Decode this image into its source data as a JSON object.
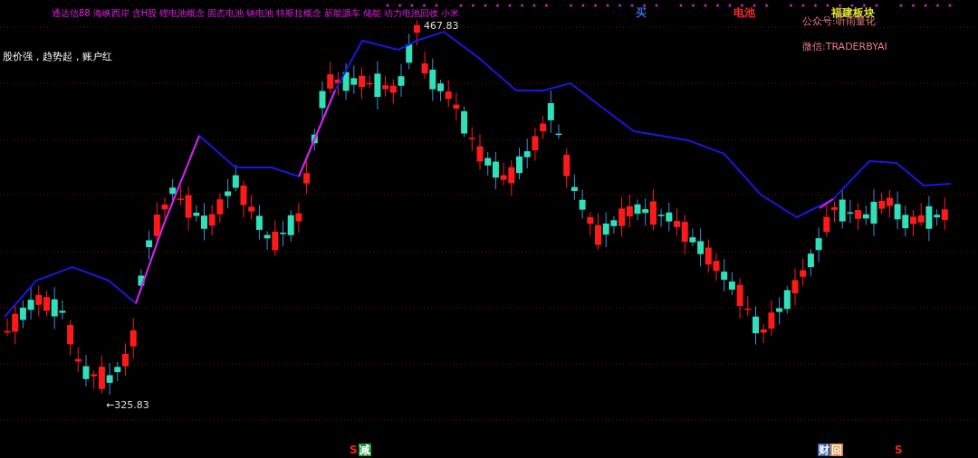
{
  "concept_tags": [
    "通达信88",
    "海峡西岸",
    "含H股",
    "锂电池概念",
    "固态电池",
    "钠电池",
    "特斯拉概念",
    "新能源车",
    "储能",
    "动力电池回收",
    "小米"
  ],
  "slogan": "股价强，趋势起，账户红",
  "signals": [
    {
      "text": "买",
      "color": "#3a6fe0"
    },
    {
      "text": "电池",
      "color": "#ff2a2a"
    },
    {
      "text": "福建板块",
      "color": "#e6e633"
    }
  ],
  "contacts": [
    "公众号:听雨量化",
    "微信:TRADERBYAI"
  ],
  "high_label": "467.83",
  "low_label": "←325.83",
  "bottom_markers": [
    {
      "kind": "letter",
      "text": "S",
      "color": "#ff2020"
    },
    {
      "kind": "badge",
      "text": "减",
      "color": "#1f9a3a"
    },
    {
      "kind": "badge",
      "text": "财",
      "color": "#3b5fa8"
    },
    {
      "kind": "badge",
      "text": "回",
      "color": "#d98a3a"
    },
    {
      "kind": "letter",
      "text": "S",
      "color": "#ff2020"
    }
  ]
}
